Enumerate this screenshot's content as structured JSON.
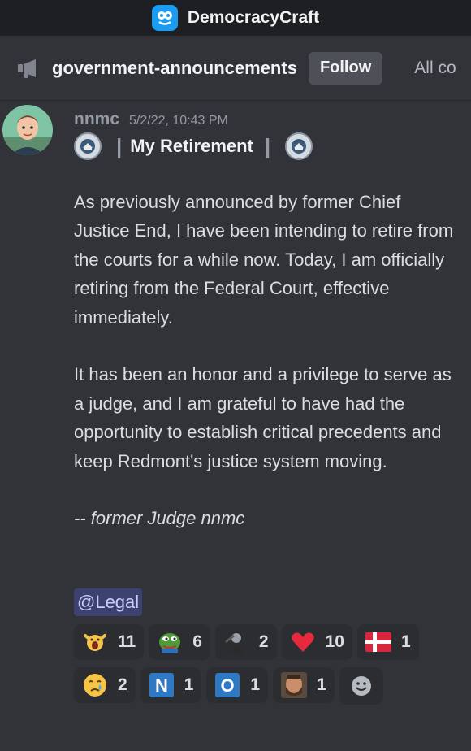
{
  "app": {
    "title": "DemocracyCraft",
    "icon": "app-logo-icon",
    "accent": "#1c9cf0"
  },
  "channel": {
    "name": "government-announcements",
    "icon": "megaphone-icon",
    "follow_label": "Follow",
    "truncated_tab": "All co"
  },
  "message": {
    "author": "nnmc",
    "timestamp": "5/2/22, 10:43 PM",
    "title": "My Retirement",
    "title_emoji": "government-seal-emoji",
    "paragraphs": [
      "As previously announced by former Chief Justice End, I have been intending to retire from the courts for a while now. Today, I am officially retiring from the Federal Court, effective immediately.",
      "It has been an honor and a privilege to serve as a judge, and I am grateful to have had the opportunity to establish critical precedents and keep Redmont's justice system moving."
    ],
    "signoff": "-- former Judge nnmc",
    "mention": "@Legal"
  },
  "reactions": [
    {
      "emoji": "dancing-person-emoji",
      "count": "11"
    },
    {
      "emoji": "pepe-frog-emoji",
      "count": "6"
    },
    {
      "emoji": "judge-figure-emoji",
      "count": "2"
    },
    {
      "emoji": "red-heart-emoji",
      "count": "10"
    },
    {
      "emoji": "flag-denmark-emoji",
      "count": "1"
    },
    {
      "emoji": "crying-face-emoji",
      "count": "2"
    },
    {
      "emoji": "letter-n-emoji",
      "count": "1"
    },
    {
      "emoji": "letter-o-emoji",
      "count": "1"
    },
    {
      "emoji": "bearded-face-emoji",
      "count": "1"
    }
  ],
  "add_reaction_icon": "add-reaction-smiley-icon"
}
